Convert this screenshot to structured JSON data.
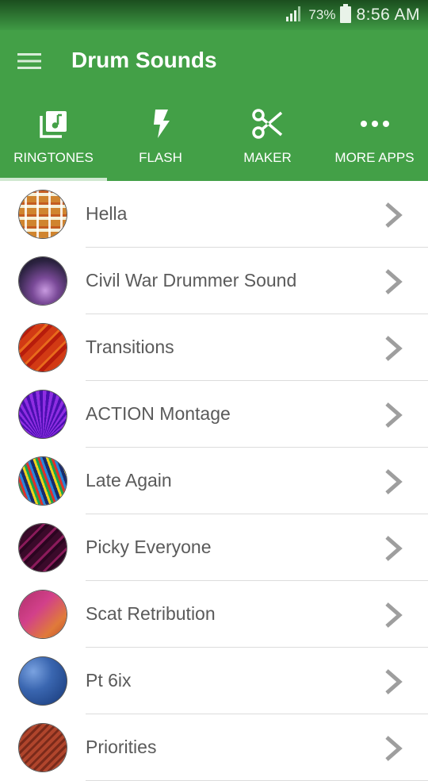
{
  "status_bar": {
    "battery_percent": "73%",
    "time": "8:56 AM"
  },
  "app_bar": {
    "title": "Drum Sounds"
  },
  "tabs": [
    {
      "label": "RINGTONES",
      "icon": "music-library-icon",
      "selected": true
    },
    {
      "label": "FLASH",
      "icon": "flash-icon",
      "selected": false
    },
    {
      "label": "MAKER",
      "icon": "scissors-icon",
      "selected": false
    },
    {
      "label": "MORE APPS",
      "icon": "more-dots-icon",
      "selected": false
    }
  ],
  "ringtones": [
    {
      "title": "Hella",
      "thumbnail": "plaid-orange"
    },
    {
      "title": "Civil War Drummer Sound",
      "thumbnail": "purple-glow"
    },
    {
      "title": "Transitions",
      "thumbnail": "red-stripes"
    },
    {
      "title": "ACTION Montage",
      "thumbnail": "purple-rays"
    },
    {
      "title": "Late Again",
      "thumbnail": "rainbow-streaks"
    },
    {
      "title": "Picky Everyone",
      "thumbnail": "dark-magenta-stripes"
    },
    {
      "title": "Scat Retribution",
      "thumbnail": "pink-orange-tiles"
    },
    {
      "title": "Pt 6ix",
      "thumbnail": "blue-marble"
    },
    {
      "title": "Priorities",
      "thumbnail": "brown-diagonal"
    }
  ],
  "colors": {
    "primary": "#43a047",
    "status_bar": "#2e7d32",
    "text": "#5a5a5a",
    "chevron": "#9e9e9e"
  }
}
